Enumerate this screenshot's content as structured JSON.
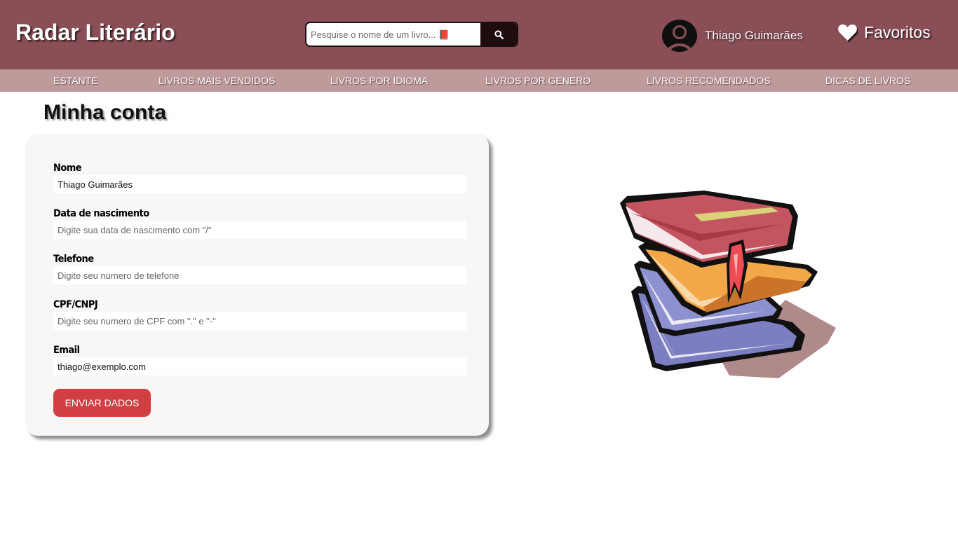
{
  "header": {
    "brand": "Radar Literário",
    "search": {
      "placeholder": "Pesquise o nome de um livro... 📕",
      "value": ""
    },
    "user": {
      "name": "Thiago Guimarães"
    },
    "favorites_label": "Favoritos"
  },
  "nav": {
    "items": [
      {
        "label": "ESTANTE"
      },
      {
        "label": "LIVROS MAIS VENDIDOS"
      },
      {
        "label": "LIVROS POR IDIOMA"
      },
      {
        "label": "LIVROS POR GENERO"
      },
      {
        "label": "LIVROS RECOMENDADOS"
      },
      {
        "label": "DICAS DE LIVROS"
      }
    ]
  },
  "main": {
    "title": "Minha conta",
    "form": {
      "fields": [
        {
          "label": "Nome",
          "value": "Thiago Guimarães",
          "placeholder": ""
        },
        {
          "label": "Data de nascimento",
          "value": "",
          "placeholder": "Digite sua data de nascimento com \"/\""
        },
        {
          "label": "Telefone",
          "value": "",
          "placeholder": "Digite seu numero de telefone"
        },
        {
          "label": "CPF/CNPJ",
          "value": "",
          "placeholder": "Digite seu numero de CPF com \".\" e \"-\""
        },
        {
          "label": "Email",
          "value": "thiago@exemplo.com",
          "placeholder": ""
        }
      ],
      "submit_label": "ENVIAR DADOS"
    }
  },
  "colors": {
    "header_bg": "#8a4e56",
    "nav_bg": "#bf9a9a",
    "search_button": "#1e0c0e",
    "submit_button": "#d13f43",
    "card_bg": "#f9f7f5"
  },
  "icons": {
    "search": "search-icon",
    "avatar": "user-avatar-icon",
    "favorites": "heart-icon",
    "illustration": "books-stack-illustration"
  }
}
